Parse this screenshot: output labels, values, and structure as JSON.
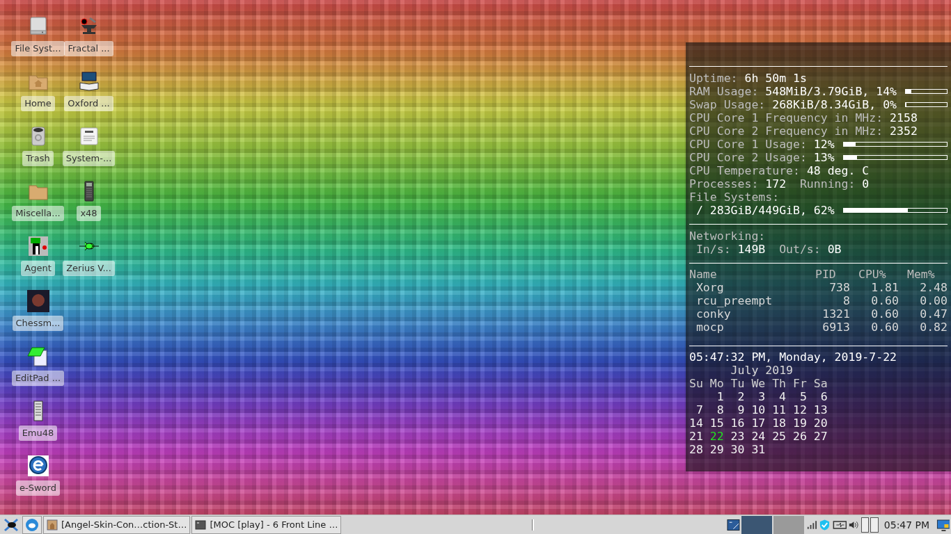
{
  "desktop_icons": [
    {
      "label": "File Syst..."
    },
    {
      "label": "Home"
    },
    {
      "label": "Trash"
    },
    {
      "label": "Miscella..."
    },
    {
      "label": "Agent"
    },
    {
      "label": "Chessm..."
    },
    {
      "label": "EditPad ..."
    },
    {
      "label": "Emu48"
    },
    {
      "label": "e-Sword"
    },
    {
      "label": "Fractal ..."
    },
    {
      "label": "Oxford ..."
    },
    {
      "label": "System-..."
    },
    {
      "label": "x48"
    },
    {
      "label": "Zerius V..."
    }
  ],
  "conky": {
    "system": [
      {
        "pairs": [
          {
            "label": "Uptime:",
            "value": "6h 50m 1s"
          }
        ]
      },
      {
        "pairs": [
          {
            "label": "RAM Usage:",
            "value": "548MiB/3.79GiB, 14%"
          }
        ],
        "level": 0.14
      },
      {
        "pairs": [
          {
            "label": "Swap Usage:",
            "value": "268KiB/8.34GiB, 0%"
          }
        ],
        "level": 0
      },
      {
        "pairs": [
          {
            "label": "CPU Core 1 Frequency in MHz:",
            "value": "2158"
          }
        ]
      },
      {
        "pairs": [
          {
            "label": "CPU Core 2 Frequency in MHz:",
            "value": "2352"
          }
        ]
      },
      {
        "pairs": [
          {
            "label": "CPU Core 1 Usage:",
            "value": "12%"
          }
        ],
        "level": 0.12
      },
      {
        "pairs": [
          {
            "label": "CPU Core 2 Usage:",
            "value": "13%"
          }
        ],
        "level": 0.13
      },
      {
        "pairs": [
          {
            "label": "CPU Temperature:",
            "value": "48 deg. C"
          }
        ]
      },
      {
        "pairs": [
          {
            "label": "Processes:",
            "value": "172"
          },
          {
            "label": "Running:",
            "value": "0"
          }
        ]
      }
    ],
    "file_systems": {
      "label": "File Systems:",
      "mounts": [
        {
          "text": "/ 283GiB/449GiB, 62%",
          "level": 0.62
        }
      ]
    },
    "networking": {
      "label": "Networking:",
      "rates": [
        {
          "label": "In/s:",
          "value": "149B"
        },
        {
          "label": "Out/s:",
          "value": "0B"
        }
      ]
    },
    "processes": {
      "columns": [
        "Name",
        "PID",
        "CPU%",
        "Mem%"
      ],
      "rows": [
        [
          "Xorg",
          "738",
          "1.81",
          "2.48"
        ],
        [
          "rcu_preempt",
          "8",
          "0.60",
          "0.00"
        ],
        [
          "conky",
          "1321",
          "0.60",
          "0.47"
        ],
        [
          "mocp",
          "6913",
          "0.60",
          "0.82"
        ]
      ]
    },
    "clock": "05:47:32 PM, Monday, 2019-7-22",
    "calendar": {
      "title": "July 2019",
      "weekdays": [
        "Su",
        "Mo",
        "Tu",
        "We",
        "Th",
        "Fr",
        "Sa"
      ],
      "weeks": [
        [
          {
            "day": "1",
            "selected": false
          },
          {
            "day": "2",
            "selected": false
          },
          {
            "day": "3",
            "selected": false
          },
          {
            "day": "4",
            "selected": false
          },
          {
            "day": "5",
            "selected": false
          },
          {
            "day": "6",
            "selected": false
          }
        ],
        [
          {
            "day": "7",
            "selected": false
          },
          {
            "day": "8",
            "selected": false
          },
          {
            "day": "9",
            "selected": false
          },
          {
            "day": "10",
            "selected": false
          },
          {
            "day": "11",
            "selected": false
          },
          {
            "day": "12",
            "selected": false
          },
          {
            "day": "13",
            "selected": false
          }
        ],
        [
          {
            "day": "14",
            "selected": false
          },
          {
            "day": "15",
            "selected": false
          },
          {
            "day": "16",
            "selected": false
          },
          {
            "day": "17",
            "selected": false
          },
          {
            "day": "18",
            "selected": false
          },
          {
            "day": "19",
            "selected": false
          },
          {
            "day": "20",
            "selected": false
          }
        ],
        [
          {
            "day": "21",
            "selected": false
          },
          {
            "day": "22",
            "selected": true
          },
          {
            "day": "23",
            "selected": false
          },
          {
            "day": "24",
            "selected": false
          },
          {
            "day": "25",
            "selected": false
          },
          {
            "day": "26",
            "selected": false
          },
          {
            "day": "27",
            "selected": false
          }
        ],
        [
          {
            "day": "28",
            "selected": false
          },
          {
            "day": "29",
            "selected": false
          },
          {
            "day": "30",
            "selected": false
          },
          {
            "day": "31",
            "selected": false
          }
        ]
      ]
    }
  },
  "taskbar": {
    "tasks": [
      {
        "title": "[Angel-Skin-Con…ction-St…"
      },
      {
        "title": "[MOC [play] - 6 Front Line …"
      }
    ],
    "workspaces": [
      {
        "selected": true
      },
      {
        "selected": false
      }
    ],
    "clock": "05:47 PM"
  }
}
